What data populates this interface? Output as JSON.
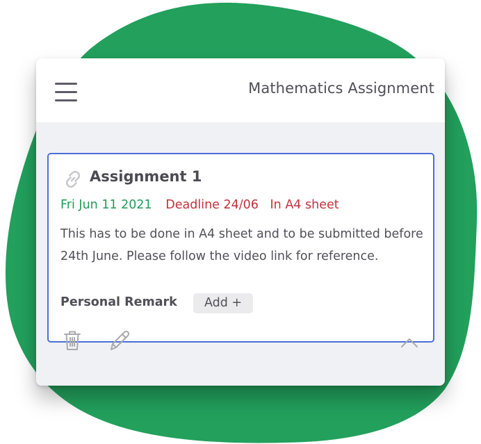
{
  "colors": {
    "blob": "#22a05c",
    "card_border": "#4a6fd8",
    "date_green": "#1f9c56",
    "deadline_red": "#c0333b",
    "content_bg": "#f0f1f4"
  },
  "appbar": {
    "menu_icon": "hamburger-menu-icon",
    "title": "Mathematics Assignment"
  },
  "assignment": {
    "icon": "link-icon",
    "title": "Assignment 1",
    "date": "Fri Jun 11 2021",
    "deadline": "Deadline 24/06",
    "format": "In A4 sheet",
    "description": "This has to be done in A4 sheet and to be submitted before 24th June. Please follow the video link for reference.",
    "remark_label": "Personal Remark",
    "add_label": "Add +",
    "actions": {
      "delete_icon": "trash-icon",
      "edit_icon": "pencil-icon",
      "collapse_icon": "chevron-up-icon"
    }
  }
}
